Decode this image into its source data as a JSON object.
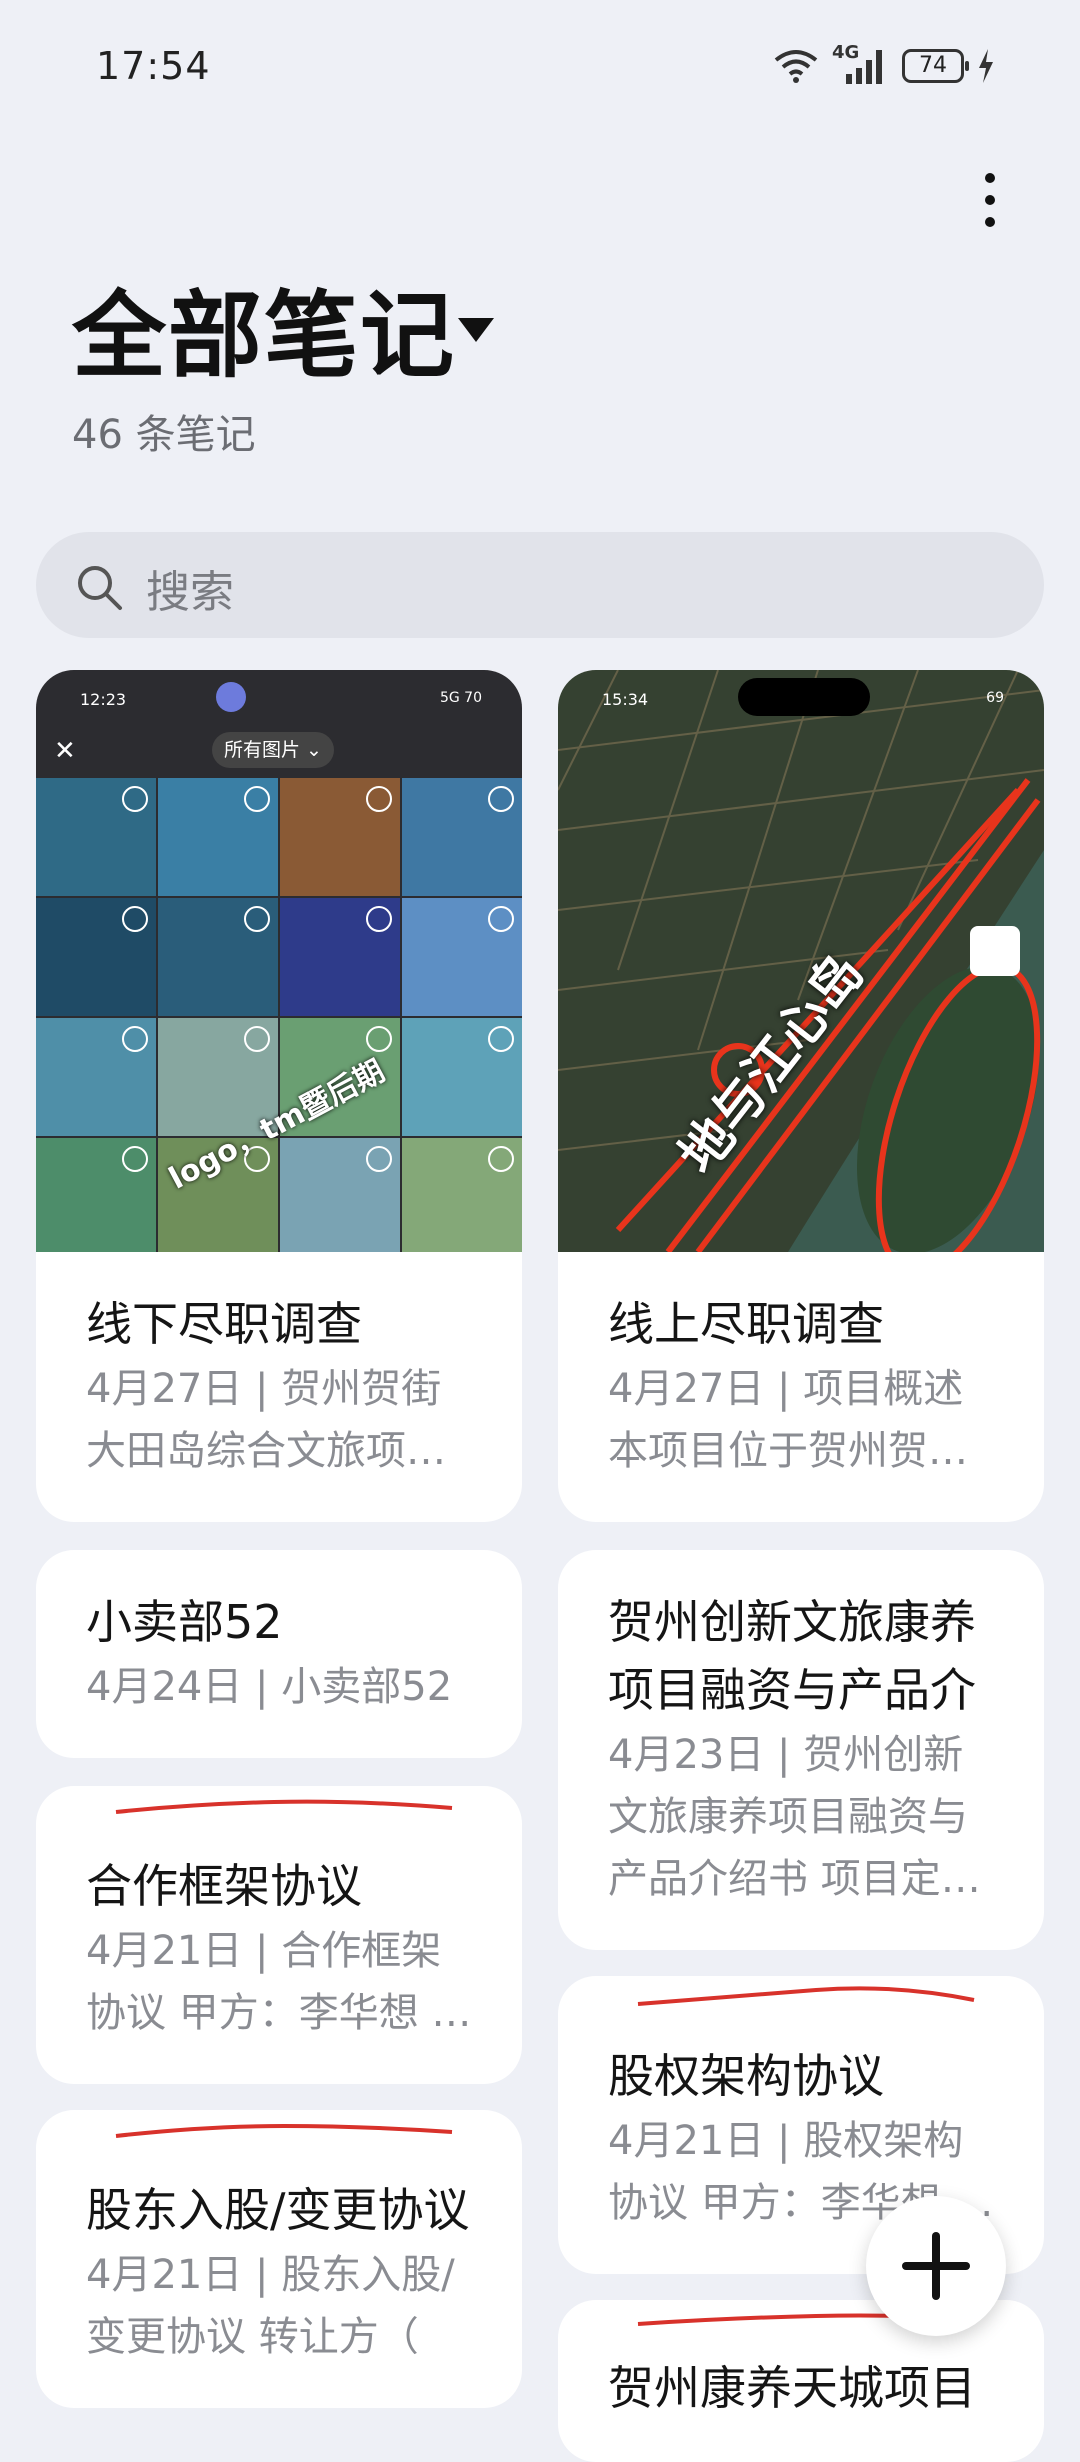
{
  "status_bar": {
    "time": "17:54",
    "network": "4G",
    "battery": "74"
  },
  "header": {
    "title": "全部笔记",
    "count": "46 条笔记"
  },
  "search": {
    "placeholder": "搜索"
  },
  "colors": {
    "background": "#eef0f6",
    "card": "#ffffff",
    "annotation_red": "#d8322b"
  },
  "thumb1": {
    "time": "12:23",
    "status": "5G 70",
    "album": "所有图片",
    "watermark": "logo，tm暨后期"
  },
  "thumb2": {
    "time": "15:34",
    "status": "69",
    "label": "地与江心岛"
  },
  "notes": [
    {
      "title": "线下尽职调查",
      "meta": "4月27日 | 贺州贺街大田岛综合文旅项…"
    },
    {
      "title": "线上尽职调查",
      "meta": "4月27日 | 项目概述本项目位于贺州贺…"
    },
    {
      "title": "小卖部52",
      "meta": "4月24日 | 小卖部52"
    },
    {
      "title": "贺州创新文旅康养项目融资与产品介",
      "meta": "4月23日 | 贺州创新文旅康养项目融资与产品介绍书 项目定…"
    },
    {
      "title": "合作框架协议",
      "meta": "4月21日 | 合作框架协议 甲方：李华想 …"
    },
    {
      "title": "股权架构协议",
      "meta": "4月21日 | 股权架构协议 甲方：李华想 …"
    },
    {
      "title": "股东入股/变更协议",
      "meta": "4月21日 | 股东入股/变更协议 转让方（"
    },
    {
      "title": "贺州康养天城项目",
      "meta": ""
    }
  ]
}
